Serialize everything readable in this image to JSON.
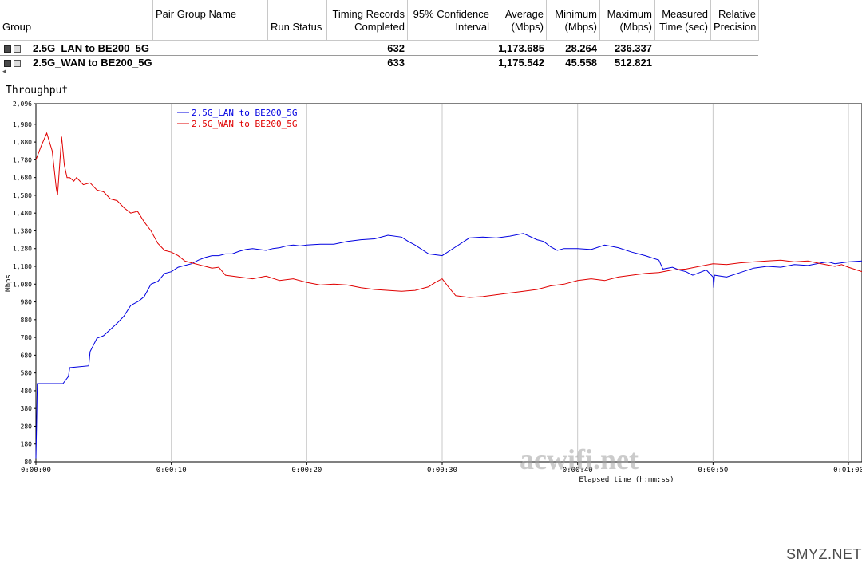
{
  "table": {
    "columns": [
      "Group",
      "Pair Group Name",
      "Run Status",
      "Timing Records Completed",
      "95% Confidence Interval",
      "Average (Mbps)",
      "Minimum (Mbps)",
      "Maximum (Mbps)",
      "Measured Time (sec)",
      "Relative Precision"
    ],
    "rows": [
      {
        "group": "2.5G_LAN to BE200_5G",
        "records": "632",
        "average": "1,173.685",
        "minimum": "28.264",
        "maximum": "236.337"
      },
      {
        "group": "2.5G_WAN to BE200_5G",
        "records": "633",
        "average": "1,175.542",
        "minimum": "45.558",
        "maximum": "512.821"
      }
    ]
  },
  "graph_title": "Throughput",
  "watermarks": [
    "acwifi.net",
    "SMYZ.NET"
  ],
  "chart_data": {
    "type": "line",
    "title": "Throughput",
    "xlabel": "Elapsed time (h:mm:ss)",
    "ylabel": "Mbps",
    "xlim": [
      0,
      61
    ],
    "ylim": [
      80,
      2096
    ],
    "yticks": [
      80,
      180,
      280,
      380,
      480,
      580,
      680,
      780,
      880,
      980,
      1080,
      1180,
      1280,
      1380,
      1480,
      1580,
      1680,
      1780,
      1880,
      1980,
      2096
    ],
    "ytick_labels": [
      "80",
      "180",
      "280",
      "380",
      "480",
      "580",
      "680",
      "780",
      "880",
      "980",
      "1,080",
      "1,180",
      "1,280",
      "1,380",
      "1,480",
      "1,580",
      "1,680",
      "1,780",
      "1,880",
      "1,980",
      "2,096"
    ],
    "xticks": [
      0,
      10,
      20,
      30,
      40,
      50,
      60
    ],
    "xtick_labels": [
      "0:00:00",
      "0:00:10",
      "0:00:20",
      "0:00:30",
      "0:00:40",
      "0:00:50",
      "0:01:00"
    ],
    "grid": true,
    "legend_position": "top-left",
    "series": [
      {
        "name": "2.5G_LAN to BE200_5G",
        "color": "#0000e0",
        "x": [
          0,
          0.05,
          0.1,
          2.0,
          2.4,
          2.5,
          3.9,
          4.0,
          4.4,
          4.5,
          5.0,
          6.0,
          6.5,
          7.0,
          7.6,
          8.0,
          8.5,
          9.0,
          9.5,
          10.0,
          10.5,
          11.0,
          11.5,
          12.0,
          12.5,
          13.0,
          13.5,
          14.0,
          14.5,
          15.0,
          15.5,
          16.0,
          16.5,
          17.0,
          17.5,
          18.0,
          18.5,
          19.0,
          19.5,
          20.0,
          21.0,
          22.0,
          23.0,
          24.0,
          25.0,
          26.0,
          27.0,
          27.5,
          28.0,
          29.0,
          30.0,
          31.0,
          32.0,
          33.0,
          34.0,
          35.0,
          36.0,
          37.0,
          37.5,
          38.0,
          38.5,
          39.0,
          40.0,
          41.0,
          42.0,
          43.0,
          44.0,
          45.0,
          46.0,
          46.3,
          47.0,
          47.5,
          48.0,
          48.5,
          49.0,
          49.5,
          50.0,
          50.05,
          50.1,
          51.0,
          52.0,
          53.0,
          54.0,
          55.0,
          56.0,
          57.0,
          58.0,
          58.5,
          59.0,
          60.0,
          61.0
        ],
        "y": [
          100,
          280,
          520,
          520,
          560,
          610,
          620,
          700,
          760,
          775,
          790,
          860,
          900,
          960,
          985,
          1010,
          1080,
          1095,
          1140,
          1150,
          1175,
          1185,
          1195,
          1215,
          1230,
          1240,
          1240,
          1250,
          1250,
          1265,
          1275,
          1280,
          1275,
          1270,
          1280,
          1285,
          1295,
          1300,
          1295,
          1300,
          1305,
          1305,
          1320,
          1330,
          1335,
          1355,
          1345,
          1320,
          1300,
          1250,
          1240,
          1290,
          1340,
          1345,
          1340,
          1350,
          1365,
          1330,
          1320,
          1290,
          1270,
          1280,
          1280,
          1275,
          1300,
          1285,
          1260,
          1240,
          1215,
          1165,
          1175,
          1160,
          1150,
          1130,
          1145,
          1160,
          1120,
          1060,
          1130,
          1120,
          1145,
          1170,
          1180,
          1175,
          1190,
          1185,
          1200,
          1205,
          1195,
          1205,
          1210
        ]
      },
      {
        "name": "2.5G_WAN to BE200_5G",
        "color": "#e00000",
        "x": [
          0,
          0.4,
          0.8,
          1.2,
          1.5,
          1.6,
          1.9,
          2.1,
          2.3,
          2.5,
          2.8,
          3.0,
          3.5,
          4.0,
          4.5,
          5.0,
          5.5,
          6.0,
          6.5,
          7.0,
          7.5,
          8.0,
          8.5,
          9.0,
          9.5,
          10.0,
          10.5,
          11.0,
          11.5,
          12.0,
          12.5,
          13.0,
          13.5,
          14.0,
          15.0,
          16.0,
          17.0,
          18.0,
          19.0,
          20.0,
          21.0,
          22.0,
          23.0,
          24.0,
          25.0,
          26.0,
          27.0,
          28.0,
          29.0,
          29.5,
          30.0,
          30.5,
          31.0,
          32.0,
          33.0,
          34.0,
          35.0,
          36.0,
          37.0,
          38.0,
          39.0,
          40.0,
          41.0,
          42.0,
          43.0,
          44.0,
          45.0,
          46.0,
          47.0,
          48.0,
          49.0,
          50.0,
          51.0,
          52.0,
          53.0,
          54.0,
          55.0,
          56.0,
          57.0,
          58.0,
          59.0,
          59.5,
          60.0,
          61.0
        ],
        "y": [
          1780,
          1860,
          1930,
          1830,
          1620,
          1580,
          1910,
          1750,
          1680,
          1680,
          1660,
          1680,
          1640,
          1650,
          1610,
          1600,
          1560,
          1550,
          1510,
          1480,
          1490,
          1430,
          1380,
          1310,
          1270,
          1260,
          1240,
          1210,
          1200,
          1190,
          1180,
          1170,
          1175,
          1130,
          1120,
          1110,
          1125,
          1100,
          1110,
          1090,
          1075,
          1080,
          1075,
          1060,
          1050,
          1045,
          1040,
          1045,
          1065,
          1090,
          1110,
          1060,
          1015,
          1005,
          1010,
          1020,
          1030,
          1040,
          1050,
          1070,
          1080,
          1100,
          1110,
          1100,
          1120,
          1130,
          1140,
          1145,
          1160,
          1165,
          1180,
          1195,
          1190,
          1200,
          1205,
          1210,
          1215,
          1205,
          1210,
          1195,
          1180,
          1190,
          1175,
          1150
        ]
      }
    ]
  }
}
